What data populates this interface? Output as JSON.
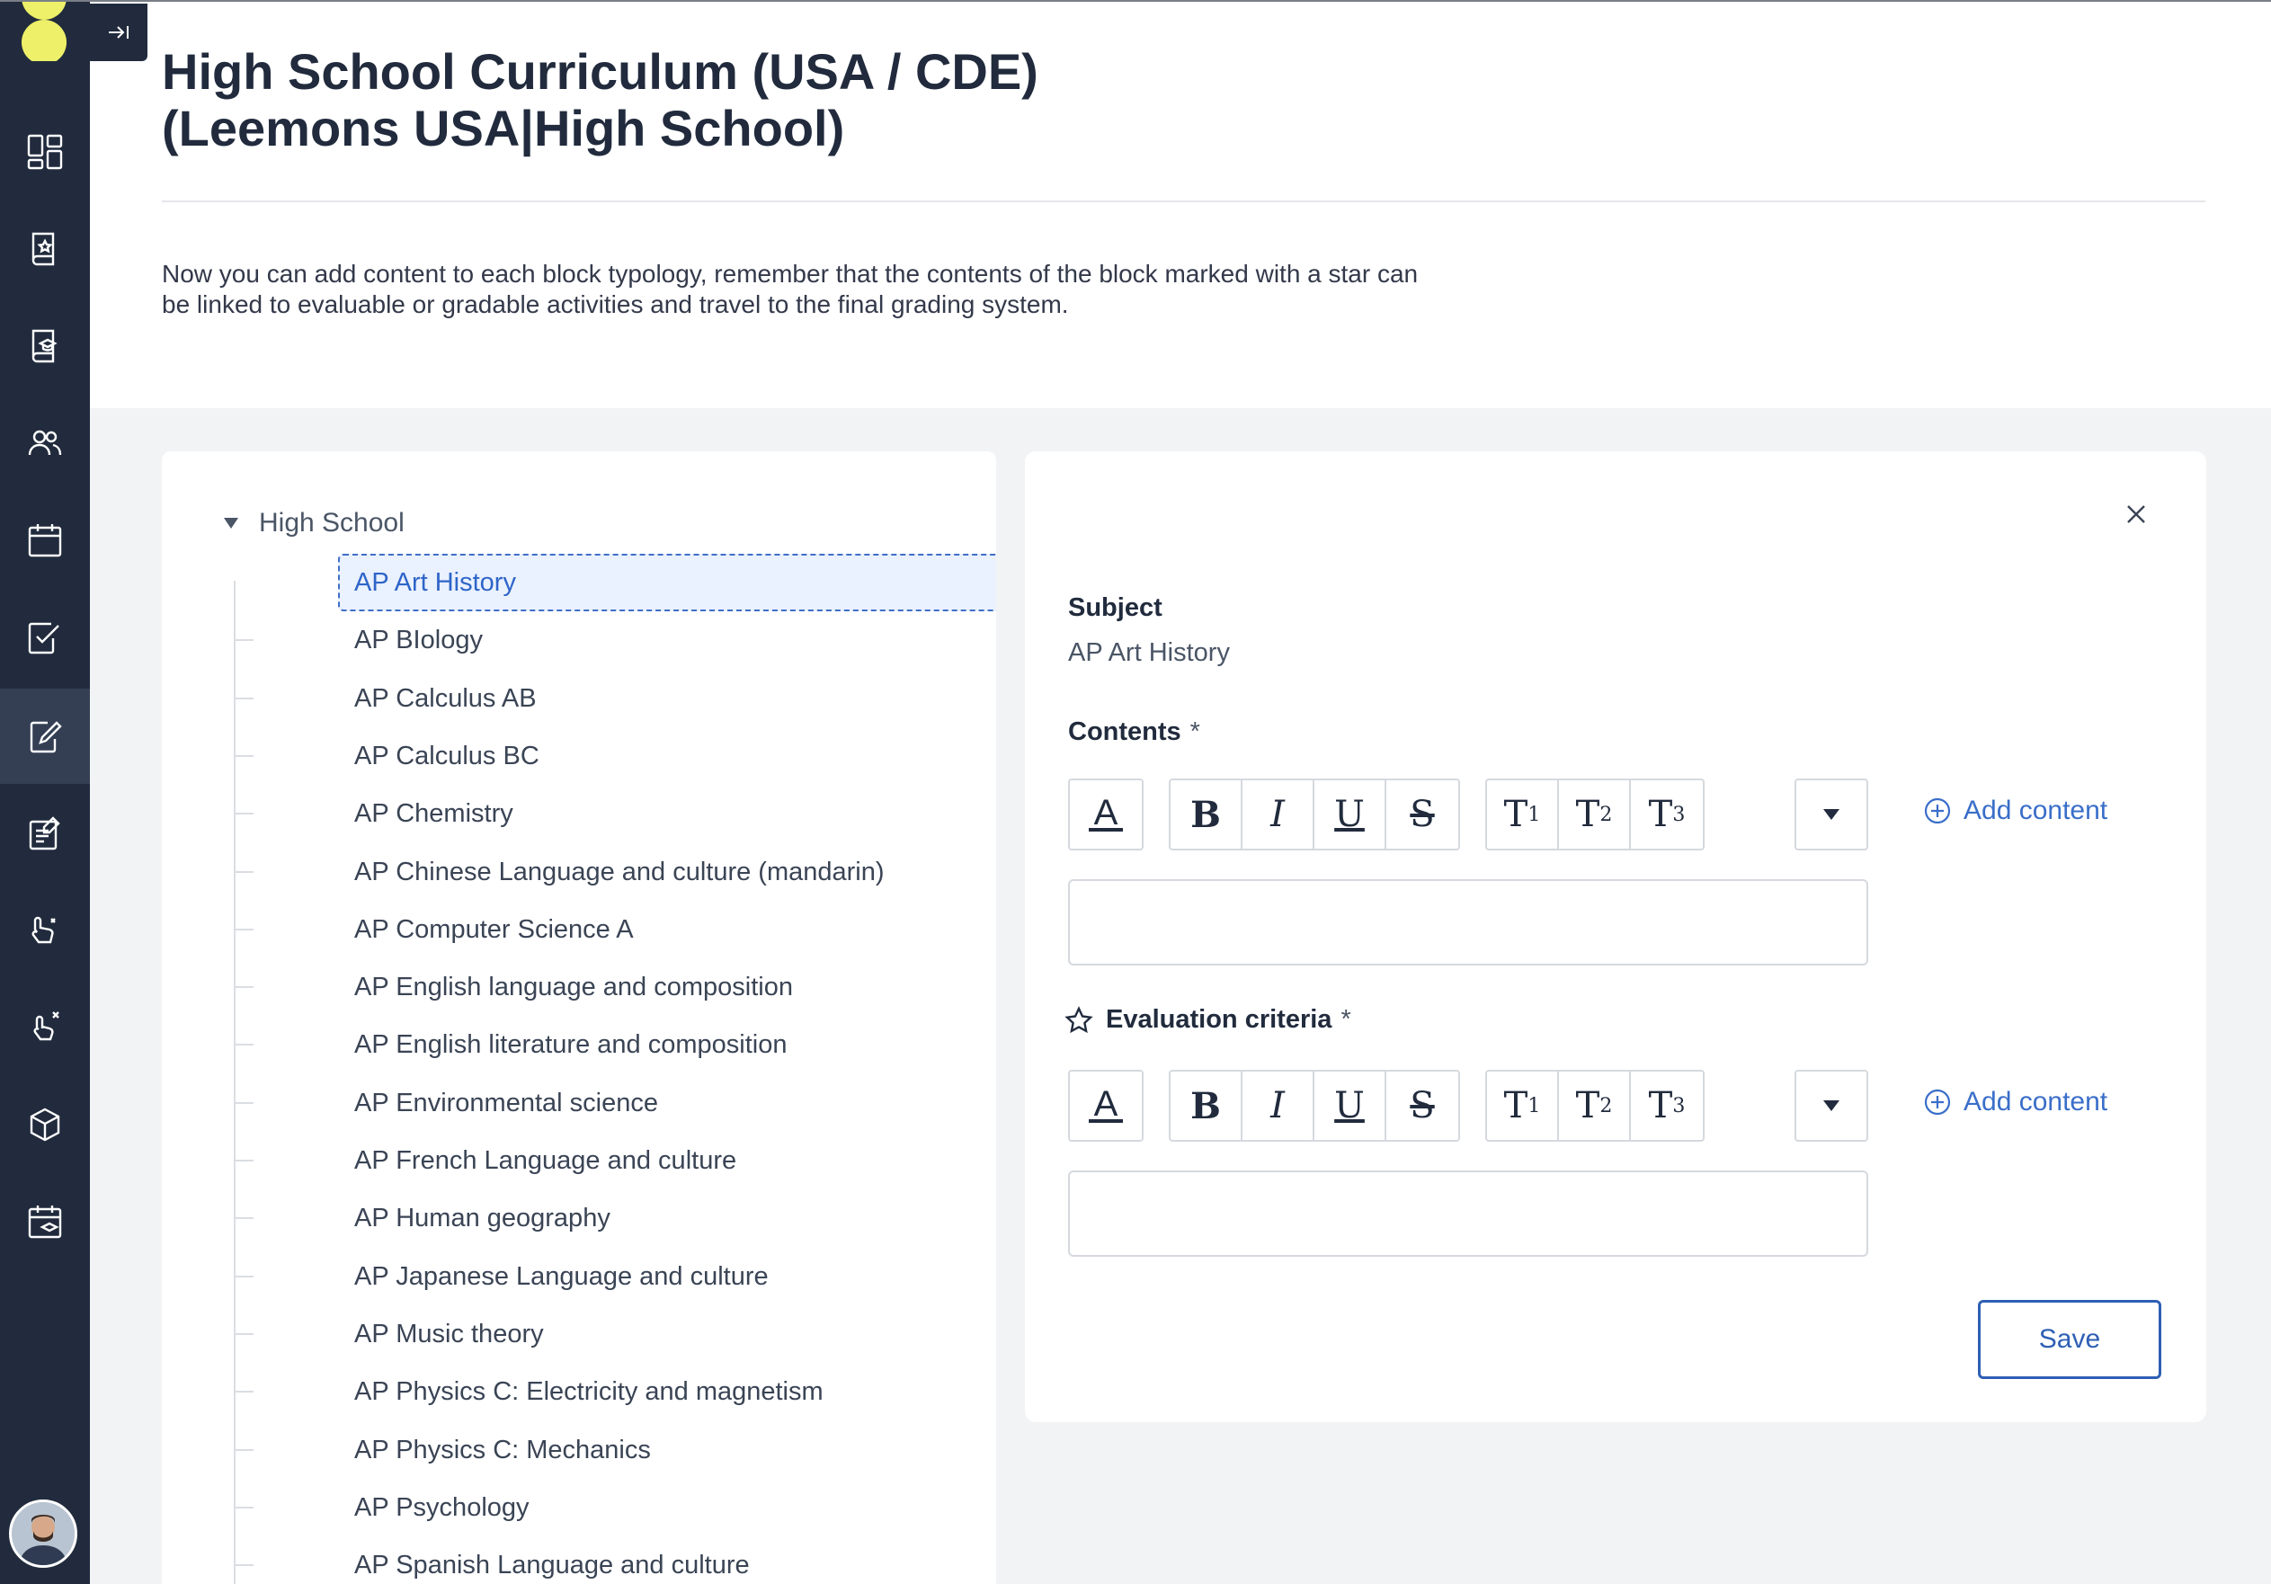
{
  "header": {
    "title_line1": "High School Curriculum (USA / CDE)",
    "title_line2": "(Leemons USA|High School)",
    "description_line1": "Now you can add content to each block typology, remember that the contents of the block marked with a star can",
    "description_line2": "be linked to evaluable or gradable activities and travel to the final grading system."
  },
  "sidebar": {
    "items": [
      {
        "icon": "dashboard-icon"
      },
      {
        "icon": "book-star-icon"
      },
      {
        "icon": "book-graduation-icon"
      },
      {
        "icon": "users-icon"
      },
      {
        "icon": "calendar-icon"
      },
      {
        "icon": "checklist-icon"
      },
      {
        "icon": "edit-document-icon",
        "active": true
      },
      {
        "icon": "assignment-icon"
      },
      {
        "icon": "evaluation-icon"
      },
      {
        "icon": "hand-cross-icon"
      },
      {
        "icon": "cube-icon"
      },
      {
        "icon": "calendar-graduation-icon"
      }
    ]
  },
  "tree": {
    "root_label": "High School",
    "items": [
      "AP Art History",
      "AP BIology",
      "AP Calculus AB",
      "AP Calculus BC",
      "AP Chemistry",
      "AP Chinese Language and culture (mandarin)",
      "AP Computer Science A",
      "AP English language and composition",
      "AP English literature and composition",
      "AP Environmental science",
      "AP French Language and culture",
      "AP Human geography",
      "AP Japanese Language and culture",
      "AP Music theory",
      "AP Physics C: Electricity and magnetism",
      "AP Physics C: Mechanics",
      "AP Psychology",
      "AP Spanish Language and culture"
    ],
    "selected_index": 0
  },
  "form": {
    "subject_label": "Subject",
    "subject_value": "AP Art History",
    "contents_label": "Contents",
    "evaluation_label": "Evaluation criteria",
    "required_mark": "*",
    "add_content_label": "Add content",
    "save_label": "Save",
    "toolbar": {
      "color": "A",
      "bold": "B",
      "italic": "I",
      "underline": "U",
      "strike": "S",
      "t": "T",
      "h1": "1",
      "h2": "2",
      "h3": "3"
    }
  },
  "colors": {
    "sidebar": "#212b3d",
    "accent": "#2e65c8",
    "logo": "#eef069"
  }
}
